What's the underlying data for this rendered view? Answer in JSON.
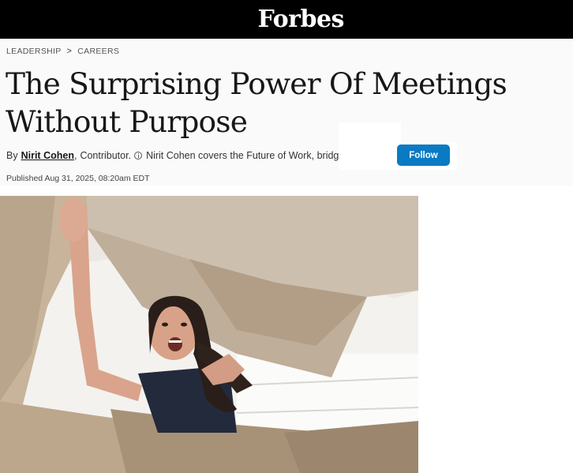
{
  "brand": {
    "logo_text": "Forbes"
  },
  "breadcrumb": {
    "items": [
      "LEADERSHIP",
      "CAREERS"
    ],
    "separator": ">"
  },
  "article": {
    "headline": "The Surprising Power Of Meetings Without Purpose",
    "byline_prefix": "By",
    "author": "Nirit Cohen",
    "role": "Contributor.",
    "author_bio": "Nirit Cohen covers the Future of Work, bridg",
    "follow_label": "Follow",
    "published": "Published Aug 31, 2025, 08:20am EDT"
  },
  "hero_image": {
    "icon": "woman-opening-box-photo"
  },
  "colors": {
    "topbar": "#000000",
    "follow": "#0a7ac3",
    "header_bg": "#fafafa"
  }
}
